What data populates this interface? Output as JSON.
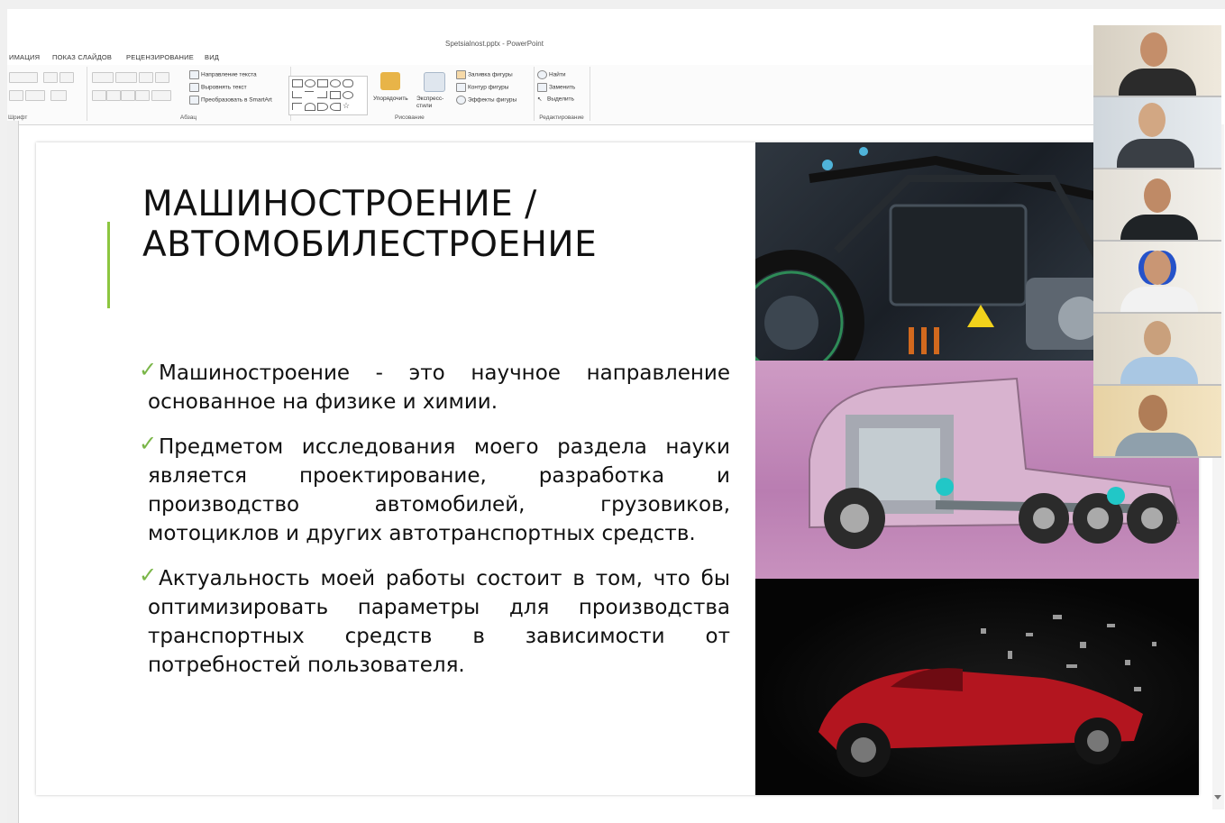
{
  "window": {
    "title": "Spetsialnost.pptx - PowerPoint"
  },
  "ribbon": {
    "tabs": [
      "ИМАЦИЯ",
      "ПОКАЗ СЛАЙДОВ",
      "РЕЦЕНЗИРОВАНИЕ",
      "ВИД"
    ],
    "groups": {
      "font_label": "Шрифт",
      "paragraph_label": "Абзац",
      "drawing_label": "Рисование",
      "editing_label": "Редактирование"
    },
    "paragraph_items": [
      "Направление текста",
      "Выровнять текст",
      "Преобразовать в SmartArt"
    ],
    "drawing_items": {
      "arrange": "Упорядочить",
      "quick_styles": "Экспресс-стили",
      "fill": "Заливка фигуры",
      "outline": "Контур фигуры",
      "effects": "Эффекты фигуры"
    },
    "editing_items": [
      "Найти",
      "Заменить",
      "Выделить"
    ]
  },
  "slide": {
    "title_line1": "МАШИНОСТРОЕНИЕ /",
    "title_line2": "АВТОМОБИЛЕСТРОЕНИЕ",
    "check_glyph": "✓",
    "bullets": [
      "Машиностроение - это научное направление основанное на физике и химии.",
      "Предметом исследования моего раздела науки является проектирование, разработка и производство автомобилей, грузовиков, мотоциклов и других автотранспортных средств.",
      "Актуальность моей работы состоит в том, что бы оптимизировать параметры для производства транспортных средств в зависимости от потребностей пользователя."
    ]
  },
  "colors": {
    "accent_green": "#8cc63f",
    "check_green": "#7ab648",
    "truck_bg": "#c891be",
    "car_red": "#b3151f"
  },
  "images": [
    "motorcycle-photo",
    "truck-cutaway-photo",
    "racecar-exploding-photo"
  ],
  "video_participants_count": 6
}
